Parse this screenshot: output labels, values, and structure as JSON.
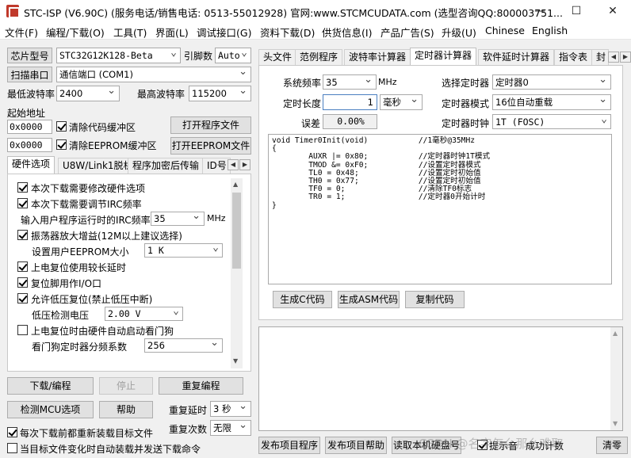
{
  "window": {
    "title": "STC-ISP (V6.90C) (服务电话/销售电话: 0513-55012928) 官网:www.STCMCUDATA.com  (选型咨询QQ:800003751...",
    "minimize": "—",
    "maximize": "☐",
    "close": "✕"
  },
  "menu": [
    "文件(F)",
    "编程/下载(O)",
    "工具(T)",
    "界面(L)",
    "调试接口(G)",
    "资料下载(D)",
    "供货信息(I)",
    "产品广告(S)",
    "升级(U)",
    "Chinese",
    "English"
  ],
  "left": {
    "chip_label": "芯片型号",
    "chip_value": "STC32G12K128-Beta",
    "pin_label": "引脚数",
    "pin_value": "Auto",
    "scan_button": "扫描串口",
    "port_value": "通信端口 (COM1)",
    "min_baud_label": "最低波特率",
    "min_baud_value": "2400",
    "max_baud_label": "最高波特率",
    "max_baud_value": "115200",
    "start_addr_label": "起始地址",
    "addr1": "0x0000",
    "clear_code_label": "清除代码缓冲区",
    "open_prog_button": "打开程序文件",
    "addr2": "0x0000",
    "clear_eeprom_label": "清除EEPROM缓冲区",
    "open_eeprom_button": "打开EEPROM文件",
    "tabs": [
      "硬件选项",
      "U8W/Link1脱机",
      "程序加密后传输",
      "ID号"
    ],
    "hw_options": {
      "opt1": "本次下载需要修改硬件选项",
      "opt2": "本次下载需要调节IRC频率",
      "irc_label": "输入用户程序运行时的IRC频率",
      "irc_value": "35",
      "irc_unit": "MHz",
      "opt3": "振荡器放大增益(12M以上建议选择)",
      "eeprom_size_label": "设置用户EEPROM大小",
      "eeprom_size_value": "1   K",
      "opt4": "上电复位使用较长延时",
      "opt5": "复位脚用作I/O口",
      "opt6": "允许低压复位(禁止低压中断)",
      "lvd_label": "低压检测电压",
      "lvd_value": "2.00 V",
      "opt7": "上电复位时由硬件自动启动看门狗",
      "wdt_label": "看门狗定时器分频系数",
      "wdt_value": "256"
    },
    "download_button": "下载/编程",
    "stop_button": "停止",
    "reprogram_button": "重复编程",
    "check_mcu_button": "检测MCU选项",
    "help_button": "帮助",
    "repeat_delay_label": "重复延时",
    "repeat_delay_value": "3 秒",
    "reload_label": "每次下载前都重新装载目标文件",
    "repeat_count_label": "重复次数",
    "repeat_count_value": "无限",
    "auto_load_label": "当目标文件变化时自动装载并发送下载命令"
  },
  "right": {
    "tabs": [
      "头文件",
      "范例程序",
      "波特率计算器",
      "定时器计算器",
      "软件延时计算器",
      "指令表",
      "封"
    ],
    "sys_freq_label": "系统频率",
    "sys_freq_value": "35",
    "sys_freq_unit": "MHz",
    "select_timer_label": "选择定时器",
    "select_timer_value": "定时器0",
    "timer_len_label": "定时长度",
    "timer_len_value": "1",
    "timer_len_unit": "毫秒",
    "timer_mode_label": "定时器模式",
    "timer_mode_value": "16位自动重载",
    "error_label": "误差",
    "error_value": "0.00%",
    "timer_clock_label": "定时器时钟",
    "timer_clock_value": "1T  (FOSC)",
    "code": "void Timer0Init(void)\t\t//1毫秒@35MHz\n{\n\tAUXR |= 0x80;\t\t//定时器时钟1T模式\n\tTMOD &= 0xF0;\t\t//设置定时器模式\n\tTL0 = 0x48;\t\t//设置定时初始值\n\tTH0 = 0x77;\t\t//设置定时初始值\n\tTF0 = 0;\t\t//清除TF0标志\n\tTR0 = 1;\t\t//定时器0开始计时\n}",
    "gen_c_button": "生成C代码",
    "gen_asm_button": "生成ASM代码",
    "copy_button": "复制代码",
    "bottom_buttons": [
      "发布项目程序",
      "发布项目帮助",
      "读取本机硬盘号"
    ],
    "beep_label": "提示音",
    "success_label": "成功计数",
    "clear_button": "清零",
    "watermark": "CSDN @名字怎么那么难取"
  }
}
